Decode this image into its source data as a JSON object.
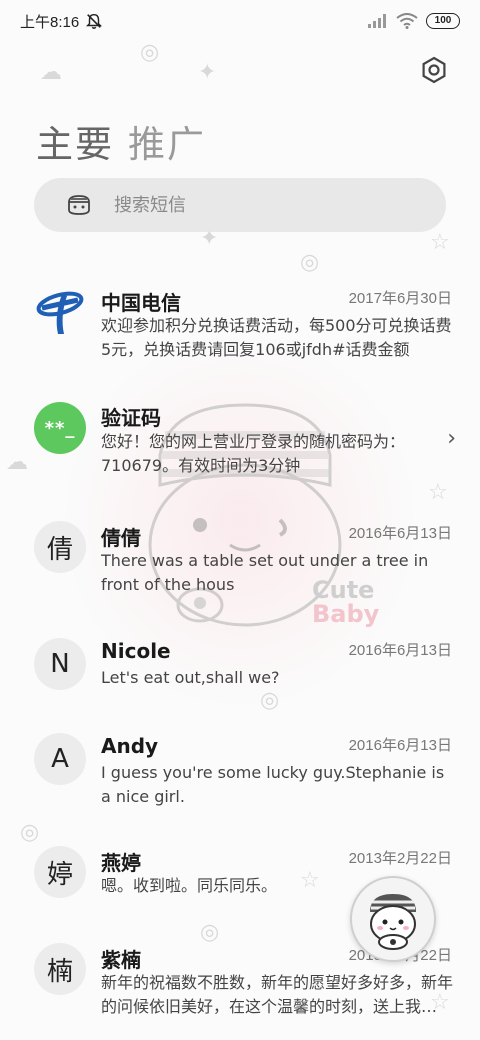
{
  "status_bar": {
    "time": "上午8:16",
    "battery": "100"
  },
  "tabs": [
    {
      "label": "主要",
      "active": true
    },
    {
      "label": "推广",
      "active": false
    }
  ],
  "search": {
    "placeholder": "搜索短信"
  },
  "watermark": {
    "line1": "Cute",
    "line2": "Baby"
  },
  "messages": [
    {
      "avatar_type": "telecom-logo",
      "avatar_text": "",
      "name": "中国电信",
      "date": "2017年6月30日",
      "preview": "欢迎参加积分兑换话费活动，每500分可兑换话费5元，兑换话费请回复106或jfdh#话费金额"
    },
    {
      "avatar_type": "green",
      "avatar_text": "**_",
      "name": "验证码",
      "date": "",
      "preview": "您好！您的网上营业厅登录的随机密码为：710679。有效时间为3分钟",
      "has_chevron": true
    },
    {
      "avatar_type": "letter",
      "avatar_text": "倩",
      "name": "倩倩",
      "date": "2016年6月13日",
      "preview": "There was a table set out under a tree in front of the hous"
    },
    {
      "avatar_type": "letter",
      "avatar_text": "N",
      "name": "Nicole",
      "date": "2016年6月13日",
      "preview": "Let's eat out,shall we?"
    },
    {
      "avatar_type": "letter",
      "avatar_text": "A",
      "name": "Andy",
      "date": "2016年6月13日",
      "preview": "I guess you're some lucky guy.Stephanie is a nice girl."
    },
    {
      "avatar_type": "letter",
      "avatar_text": "婷",
      "name": "燕婷",
      "date": "2013年2月22日",
      "preview": "嗯。收到啦。同乐同乐。"
    },
    {
      "avatar_type": "letter",
      "avatar_text": "楠",
      "name": "紫楠",
      "date": "2013年2月22日",
      "preview": "新年的祝福数不胜数，新年的愿望好多好多，新年的问候依旧美好，在这个温馨的时刻，送上我的祝福"
    }
  ],
  "colors": {
    "accent_green": "#5dc85d",
    "telecom_blue": "#1f5fb5"
  },
  "icons": {
    "settings": "gear-hexagon-icon",
    "search": "cat-face-icon",
    "mute": "bell-off-icon",
    "fab": "cat-avatar-icon"
  }
}
